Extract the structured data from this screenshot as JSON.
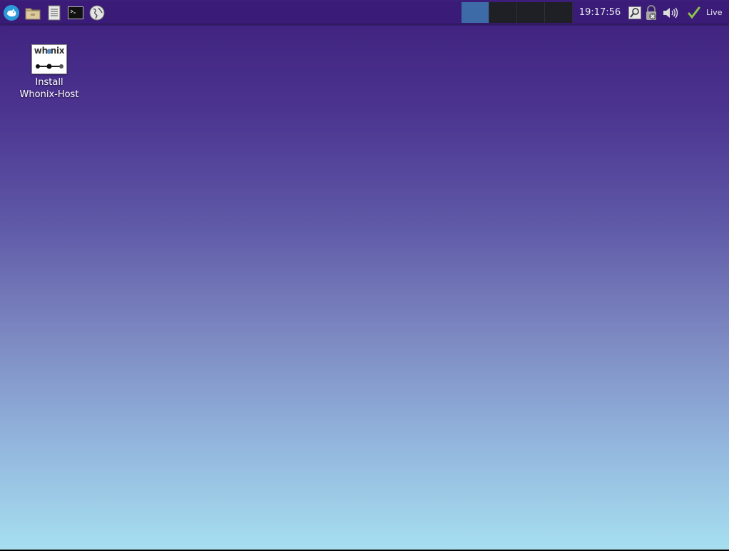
{
  "panel": {
    "launchers": [
      {
        "name": "start-menu-icon"
      },
      {
        "name": "file-manager-icon"
      },
      {
        "name": "text-editor-icon"
      },
      {
        "name": "terminal-icon"
      },
      {
        "name": "web-browser-icon"
      }
    ],
    "workspaces": [
      {
        "active": true
      },
      {
        "active": false
      },
      {
        "active": false
      },
      {
        "active": false
      }
    ],
    "clock": "19:17:56",
    "tray": [
      {
        "name": "search-icon"
      },
      {
        "name": "vpn-lock-disconnected-icon"
      },
      {
        "name": "volume-icon"
      },
      {
        "name": "checkmark-icon",
        "color": "#8bc34a"
      }
    ],
    "live_label": "Live"
  },
  "desktop": {
    "icons": [
      {
        "name": "install-whonix-host",
        "wordmark": "wh nix",
        "label_line1": "Install",
        "label_line2": "Whonix-Host"
      }
    ]
  },
  "colors": {
    "panel_bg": "#3a1c78",
    "workspace_active": "#3d6ba8",
    "workspace_inactive": "#1f1f26",
    "desktop_top": "#3e1f7c",
    "desktop_bottom": "#a6dff0"
  }
}
